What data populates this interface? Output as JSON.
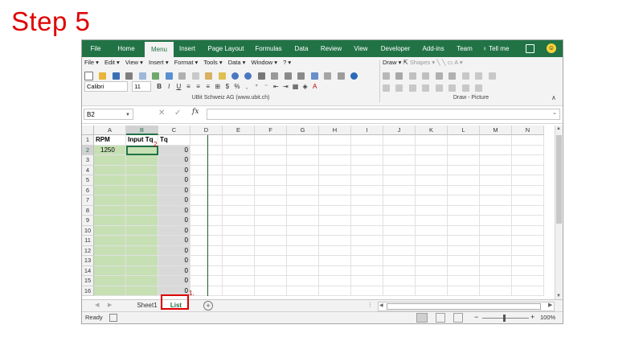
{
  "step_title": "Step 5",
  "ribbon_tabs": [
    "File",
    "Home",
    "Menu",
    "Insert",
    "Page Layout",
    "Formulas",
    "Data",
    "Review",
    "View",
    "Developer",
    "Add-ins",
    "Team"
  ],
  "active_tab": "Menu",
  "tell_me": "Tell me",
  "menu_row": [
    "File ▾",
    "Edit ▾",
    "View ▾",
    "Insert ▾",
    "Format ▾",
    "Tools ▾",
    "Data ▾",
    "Window ▾",
    "? ▾"
  ],
  "font_name": "Calibri",
  "font_size": "11",
  "group_label_menu": "UBit Schweiz AG   (www.ubit.ch)",
  "draw_label": "Draw ▾",
  "shapes_label": "Shapes ▾",
  "group_label_draw": "Draw - Picture",
  "name_box": "B2",
  "fx_symbol": "fx",
  "columns": [
    "A",
    "B",
    "C",
    "D",
    "E",
    "F",
    "G",
    "H",
    "I",
    "J",
    "K",
    "L",
    "M",
    "N"
  ],
  "selected_column": "B",
  "rows": [
    "1",
    "2",
    "3",
    "4",
    "5",
    "6",
    "7",
    "8",
    "9",
    "10",
    "11",
    "12",
    "13",
    "14",
    "15",
    "16"
  ],
  "selected_row": "2",
  "header_cells": {
    "A1": "RPM",
    "B1": "Input Tq",
    "C1": "Tq"
  },
  "cell_a2": "1250",
  "c_values": [
    "0",
    "0",
    "0",
    "0",
    "0",
    "0",
    "0",
    "0",
    "0",
    "0",
    "0",
    "0",
    "0",
    "0",
    "0"
  ],
  "annotation_1": "1.",
  "annotation_2": "2.",
  "sheets": [
    "Sheet1",
    "List"
  ],
  "active_sheet": "List",
  "status_ready": "Ready",
  "zoom_minus": "−",
  "zoom_plus": "+",
  "zoom": "100%",
  "colors": {
    "excel_green": "#217346",
    "input_green": "#c6e0b4",
    "formula_grey": "#d9d9d9",
    "highlight_red": "#dd0000"
  }
}
